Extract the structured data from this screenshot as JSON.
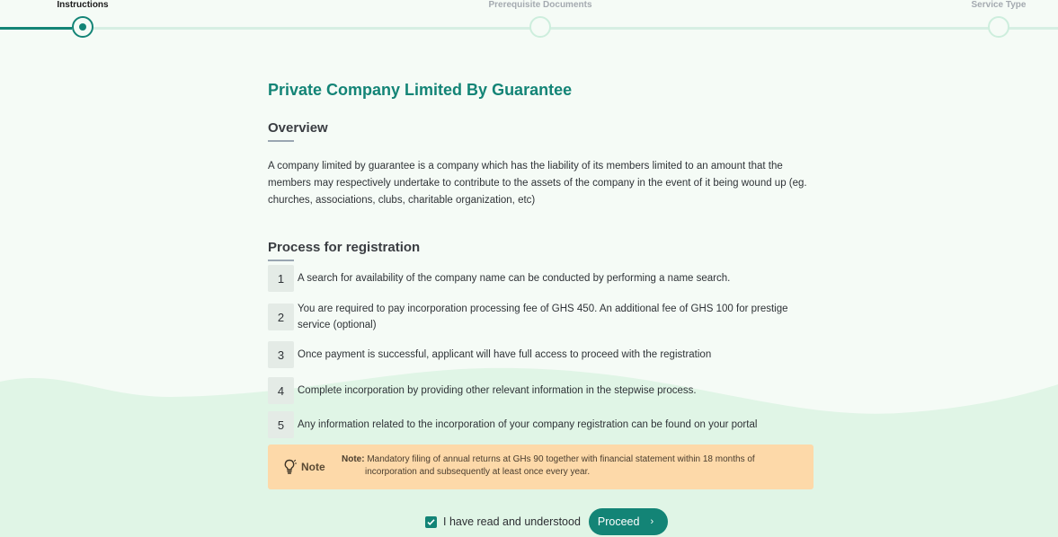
{
  "stepper": {
    "steps": [
      {
        "label": "Instructions",
        "state": "active"
      },
      {
        "label": "Prerequisite Documents",
        "state": "inactive"
      },
      {
        "label": "Service Type",
        "state": "inactive"
      }
    ]
  },
  "page": {
    "title": "Private Company Limited By Guarantee"
  },
  "overview": {
    "heading": "Overview",
    "text": "A company limited by guarantee is a company which has the liability of its members limited to an amount that the members may respectively undertake to contribute to the assets of the company in the event of it being wound up (eg. churches, associations, clubs, charitable organization, etc)"
  },
  "process": {
    "heading": "Process for registration",
    "steps": [
      {
        "num": "1",
        "text": "A search for availability of the company name can be conducted by performing a name search."
      },
      {
        "num": "2",
        "text": "You are required to pay incorporation processing fee of GHS 450. An additional fee of GHS 100 for prestige service (optional)"
      },
      {
        "num": "3",
        "text": "Once payment is successful, applicant will have full access to proceed with the registration"
      },
      {
        "num": "4",
        "text": "Complete incorporation by providing other relevant information in the stepwise process."
      },
      {
        "num": "5",
        "text": "Any information related to the incorporation of your company registration can be found on your portal"
      }
    ]
  },
  "note": {
    "title": "Note",
    "label": "Note:",
    "line1": "Mandatory filing of annual returns at GHs 90 together with financial statement within 18 months of",
    "line2": "incorporation and subsequently at least once every year."
  },
  "agreement": {
    "checked": true,
    "label": "I have read and understood",
    "proceed_label": "Proceed",
    "proceed_icon": "chevron-right-icon"
  },
  "colors": {
    "accent": "#138476",
    "note_bg": "#fdd9a9",
    "background": "#f5fbf6",
    "wave": "#e0f5e6"
  }
}
